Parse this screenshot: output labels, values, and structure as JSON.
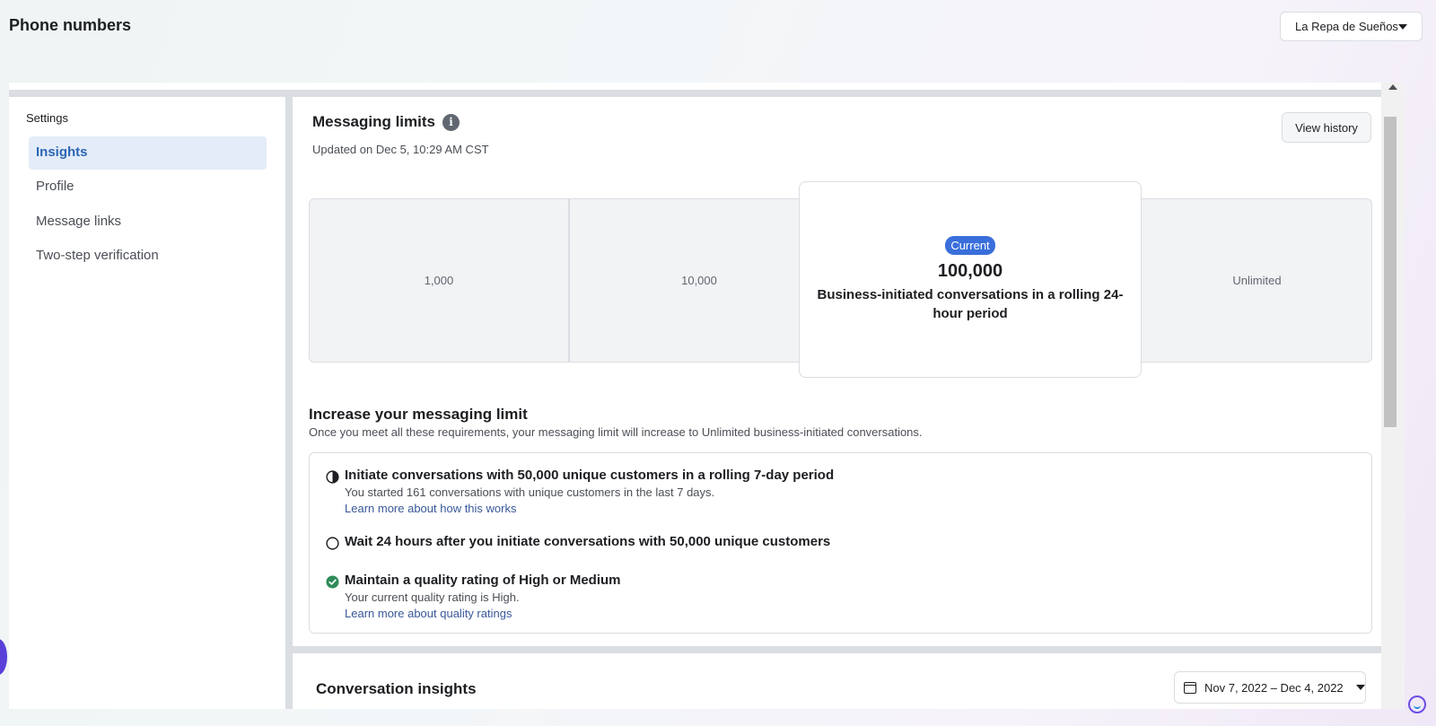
{
  "header": {
    "title": "Phone numbers",
    "account": "La Repa de Sueños"
  },
  "sidebar": {
    "heading": "Settings",
    "items": [
      {
        "label": "Insights",
        "active": true
      },
      {
        "label": "Profile",
        "active": false
      },
      {
        "label": "Message links",
        "active": false
      },
      {
        "label": "Two-step verification",
        "active": false
      }
    ]
  },
  "messaging_limits": {
    "title": "Messaging limits",
    "info_icon": "info-icon",
    "updated": "Updated on Dec 5, 10:29 AM CST",
    "view_history_label": "View history",
    "tiers": [
      "1,000",
      "10,000",
      "Unlimited"
    ],
    "current": {
      "badge": "Current",
      "value": "100,000",
      "description": "Business-initiated conversations in a rolling 24-hour period"
    }
  },
  "increase": {
    "title": "Increase your messaging limit",
    "subtitle": "Once you meet all these requirements, your messaging limit will increase to Unlimited business-initiated conversations.",
    "requirements": [
      {
        "status": "in-progress",
        "icon": "half-circle-icon",
        "title": "Initiate conversations with 50,000 unique customers in a rolling 7-day period",
        "detail": "You started 161 conversations with unique customers in the last 7 days.",
        "link": "Learn more about how this works"
      },
      {
        "status": "not-started",
        "icon": "empty-circle-icon",
        "title": "Wait 24 hours after you initiate conversations with 50,000 unique customers"
      },
      {
        "status": "complete",
        "icon": "check-circle-icon",
        "title": "Maintain a quality rating of High or Medium",
        "detail": "Your current quality rating is High.",
        "link": "Learn more about quality ratings"
      }
    ]
  },
  "conversation_insights": {
    "title": "Conversation insights",
    "date_range": "Nov 7, 2022 – Dec 4, 2022"
  },
  "colors": {
    "accent": "#3a6fdb",
    "active_bg": "#e3ecf8",
    "link": "#385898",
    "success": "#2e8b57"
  }
}
